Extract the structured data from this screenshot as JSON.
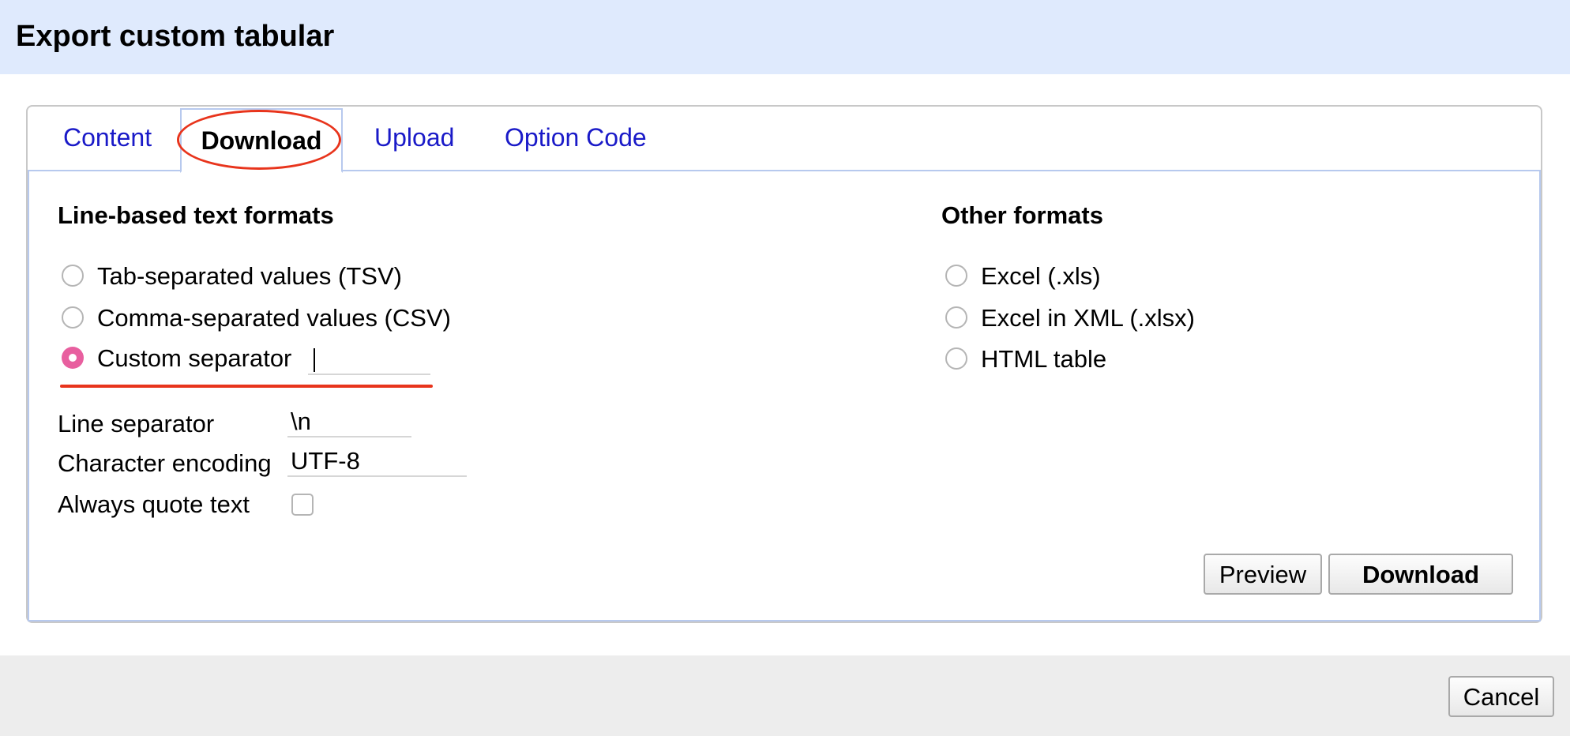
{
  "dialog": {
    "title": "Export custom tabular"
  },
  "tabs": [
    {
      "label": "Content",
      "active": false
    },
    {
      "label": "Download",
      "active": true
    },
    {
      "label": "Upload",
      "active": false
    },
    {
      "label": "Option Code",
      "active": false
    }
  ],
  "line_formats": {
    "heading": "Line-based text formats",
    "options": [
      {
        "label": "Tab-separated values (TSV)",
        "selected": false
      },
      {
        "label": "Comma-separated values (CSV)",
        "selected": false
      },
      {
        "label": "Custom separator",
        "selected": true
      }
    ],
    "custom_separator_value": ""
  },
  "other_formats": {
    "heading": "Other formats",
    "options": [
      {
        "label": "Excel (.xls)",
        "selected": false
      },
      {
        "label": "Excel in XML (.xlsx)",
        "selected": false
      },
      {
        "label": "HTML table",
        "selected": false
      }
    ]
  },
  "settings": {
    "line_separator_label": "Line separator",
    "line_separator_value": "\\n",
    "encoding_label": "Character encoding",
    "encoding_value": "UTF-8",
    "always_quote_label": "Always quote text",
    "always_quote_checked": false
  },
  "actions": {
    "preview_label": "Preview",
    "download_label": "Download",
    "cancel_label": "Cancel"
  },
  "colors": {
    "header_bg": "#dfeafd",
    "tab_link": "#1a1ac8",
    "annotation": "#e8341c",
    "radio_checked": "#e85f9f",
    "footer_bg": "#ededed"
  }
}
